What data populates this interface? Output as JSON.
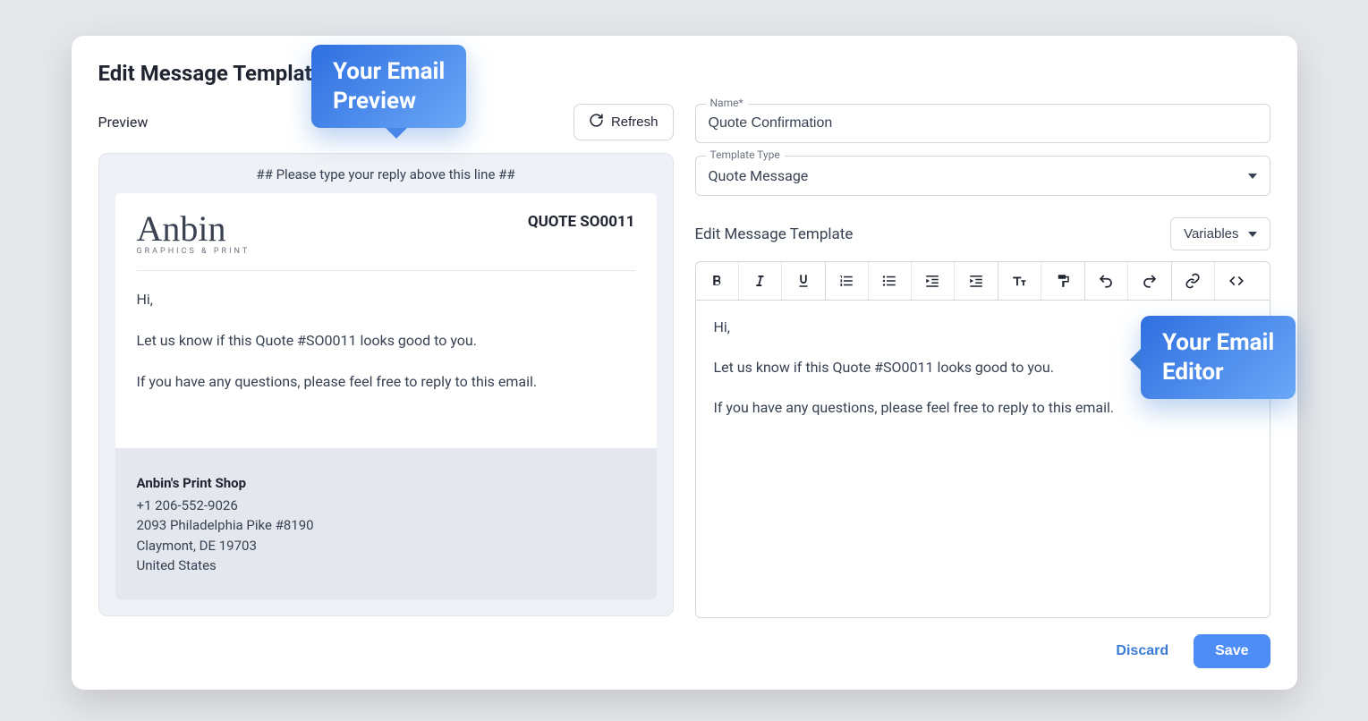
{
  "page": {
    "title": "Edit Message Template",
    "preview_label": "Preview",
    "refresh_label": "Refresh"
  },
  "callouts": {
    "preview": "Your Email Preview",
    "editor": "Your Email Editor"
  },
  "preview": {
    "reply_line": "## Please type your reply above this line ##",
    "logo_name": "Anbin",
    "logo_sub": "GRAPHICS & PRINT",
    "quote_title": "QUOTE SO0011",
    "body": [
      "Hi,",
      "Let us know if this Quote #SO0011 looks good to you.",
      "If you have any questions, please feel free to reply to this email."
    ],
    "footer": {
      "shop_name": "Anbin's Print Shop",
      "phone": "+1 206-552-9026",
      "addr1": "2093 Philadelphia Pike #8190",
      "addr2": "Claymont, DE 19703",
      "country": "United States"
    }
  },
  "form": {
    "name_label": "Name*",
    "name_value": "Quote Confirmation",
    "type_label": "Template Type",
    "type_value": "Quote Message",
    "editor_title": "Edit Message Template",
    "variables_label": "Variables",
    "body": [
      "Hi,",
      "Let us know if this Quote #SO0011 looks good to you.",
      "If you have any questions, please feel free to reply to this email."
    ]
  },
  "actions": {
    "discard": "Discard",
    "save": "Save"
  }
}
